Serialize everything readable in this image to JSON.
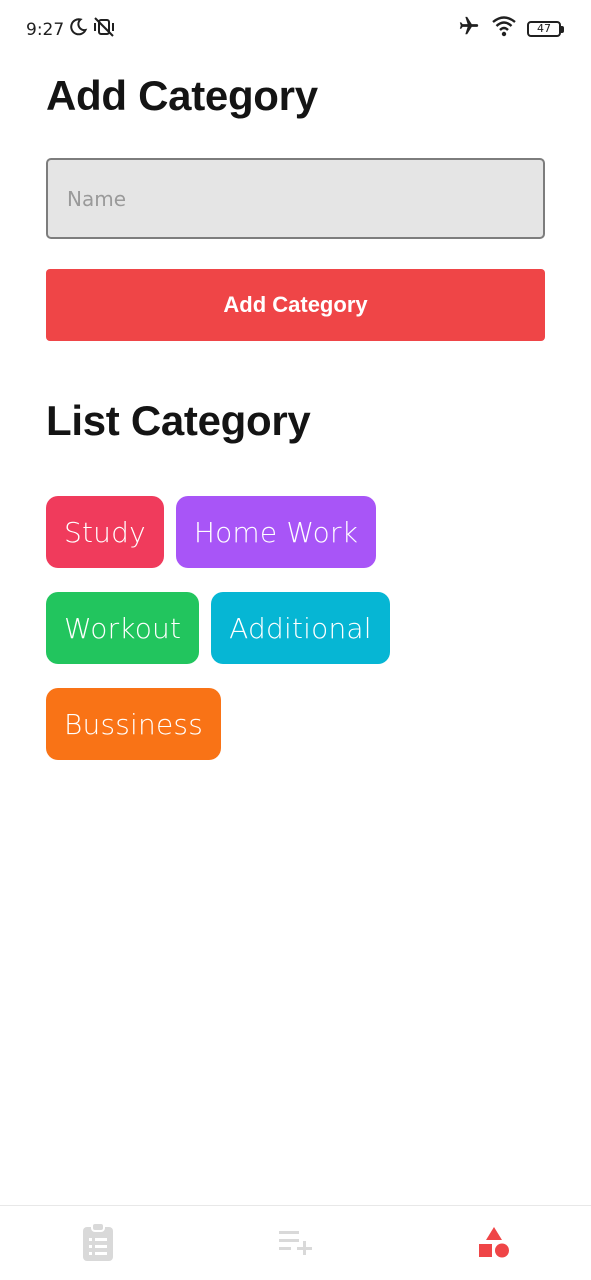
{
  "status_bar": {
    "time": "9:27",
    "battery": "47"
  },
  "add_section": {
    "title": "Add Category",
    "input_placeholder": "Name",
    "input_value": "",
    "button_label": "Add Category"
  },
  "list_section": {
    "title": "List Category"
  },
  "categories": [
    {
      "label": "Study",
      "color": "#f03b5c"
    },
    {
      "label": "Home Work",
      "color": "#a855f7"
    },
    {
      "label": "Workout",
      "color": "#22c55e"
    },
    {
      "label": "Additional",
      "color": "#06b6d4"
    },
    {
      "label": "Bussiness",
      "color": "#f97316"
    }
  ],
  "bottom_nav": {
    "items": [
      {
        "icon": "clipboard-list-icon",
        "active": false
      },
      {
        "icon": "playlist-add-icon",
        "active": false
      },
      {
        "icon": "shapes-icon",
        "active": true
      }
    ],
    "active_color": "#ef4547",
    "inactive_color": "#d9d9d9"
  },
  "accent_color": "#ef4547"
}
